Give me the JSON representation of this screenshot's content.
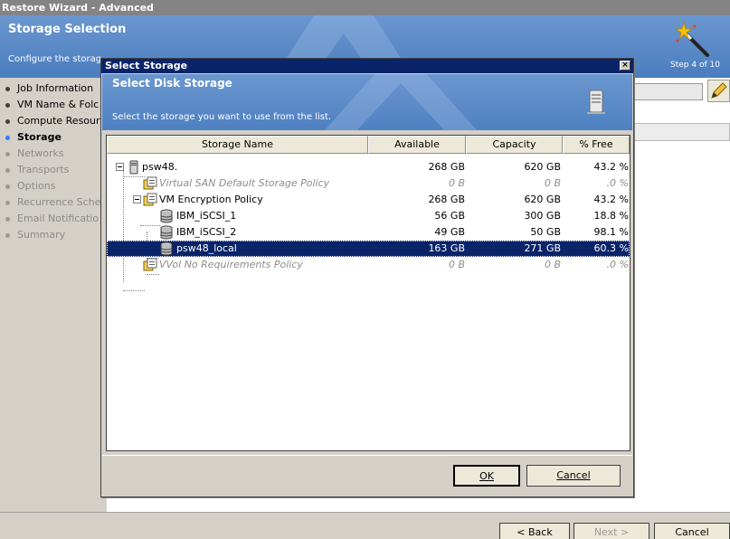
{
  "window": {
    "title": "Restore Wizard - Advanced"
  },
  "banner": {
    "title": "Storage Selection",
    "subtitle": "Configure the storag",
    "step": "Step 4 of 10",
    "icon": "magic-wand-icon"
  },
  "nav": {
    "items": [
      {
        "label": "Job Information",
        "state": "done"
      },
      {
        "label": "VM Name & Folc",
        "state": "done"
      },
      {
        "label": "Compute Resour",
        "state": "done"
      },
      {
        "label": "Storage",
        "state": "active"
      },
      {
        "label": "Networks",
        "state": "pending"
      },
      {
        "label": "Transports",
        "state": "pending"
      },
      {
        "label": "Options",
        "state": "pending"
      },
      {
        "label": "Recurrence Sche",
        "state": "pending"
      },
      {
        "label": "Email Notificatio",
        "state": "pending"
      },
      {
        "label": "Summary",
        "state": "pending"
      }
    ]
  },
  "wizard_buttons": {
    "back": "< Back",
    "next": "Next >",
    "cancel": "Cancel"
  },
  "dialog": {
    "title": "Select Storage",
    "close_glyph": "×",
    "banner_title": "Select Disk Storage",
    "banner_subtitle": "Select the storage you want to use from the list.",
    "banner_icon": "server-icon",
    "columns": [
      "Storage Name",
      "Available",
      "Capacity",
      "% Free"
    ],
    "rows": [
      {
        "name": "psw48.",
        "available": "268 GB",
        "capacity": "620 GB",
        "free": "43.2 %",
        "icon": "host-icon",
        "style": "normal"
      },
      {
        "name": "Virtual SAN Default Storage Policy",
        "available": "0 B",
        "capacity": "0 B",
        "free": ".0 %",
        "icon": "policy-icon",
        "style": "italic"
      },
      {
        "name": "VM Encryption Policy",
        "available": "268 GB",
        "capacity": "620 GB",
        "free": "43.2 %",
        "icon": "policy-icon",
        "style": "normal"
      },
      {
        "name": "IBM_iSCSI_1",
        "available": "56 GB",
        "capacity": "300 GB",
        "free": "18.8 %",
        "icon": "datastore-icon",
        "style": "normal"
      },
      {
        "name": "IBM_iSCSI_2",
        "available": "49 GB",
        "capacity": "50 GB",
        "free": "98.1 %",
        "icon": "datastore-icon",
        "style": "normal"
      },
      {
        "name": "psw48_local",
        "available": "163 GB",
        "capacity": "271 GB",
        "free": "60.3 %",
        "icon": "datastore-icon",
        "style": "selected"
      },
      {
        "name": "VVol No Requirements Policy",
        "available": "0 B",
        "capacity": "0 B",
        "free": ".0 %",
        "icon": "policy-icon",
        "style": "italic"
      }
    ],
    "ok_label": "OK",
    "cancel_label": "Cancel"
  },
  "colors": {
    "banner": "#4a7dbf",
    "titlebar": "#0a246a",
    "selection": "#0a246a",
    "active_bullet": "#2a7fff"
  }
}
